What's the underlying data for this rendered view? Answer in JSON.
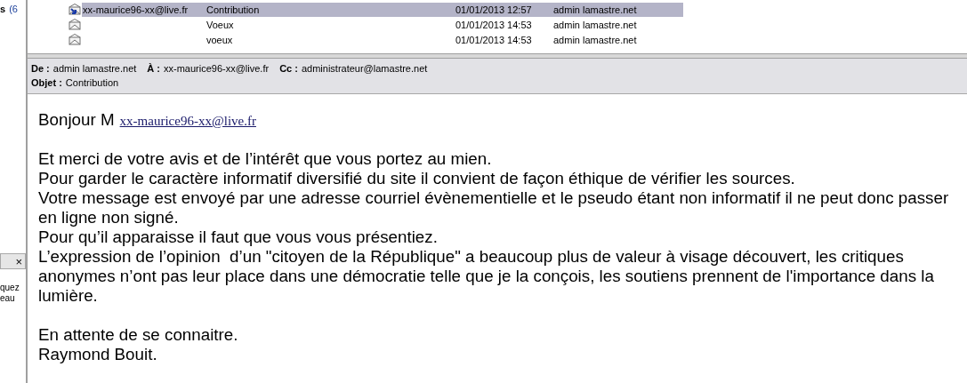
{
  "sidebar": {
    "folder_label": "s",
    "folder_count": "(6",
    "close_button": "×",
    "texts": [
      "quez",
      "eau"
    ]
  },
  "messages": [
    {
      "from": "xx-maurice96-xx@live.fr",
      "subject": "Contribution",
      "date": "01/01/2013 12:57",
      "recipient": "admin lamastre.net",
      "selected": true,
      "kind": "replied"
    },
    {
      "subject": "Voeux",
      "date": "01/01/2013 14:53",
      "recipient": "admin lamastre.net",
      "selected": false,
      "kind": "read"
    },
    {
      "subject": "voeux",
      "date": "01/01/2013 14:53",
      "recipient": "admin lamastre.net",
      "selected": false,
      "kind": "read"
    }
  ],
  "header": {
    "from_label": "De :",
    "from": "admin lamastre.net",
    "to_label": "À :",
    "to": "xx-maurice96-xx@live.fr",
    "cc_label": "Cc :",
    "cc": "administrateur@lamastre.net",
    "subject_label": "Objet :",
    "subject": "Contribution"
  },
  "body": {
    "greeting": "Bonjour M",
    "greeting_link": "xx-maurice96-xx@live.fr",
    "paragraphs": [
      "Et merci de votre avis et de l’intérêt que vous portez au mien.",
      "Pour garder le caractère informatif diversifié du site il convient de façon éthique de vérifier les sources.",
      "Votre message est envoyé par une adresse courriel évènementielle et le pseudo étant non informatif il ne peut donc passer en ligne non signé.",
      "Pour qu’il apparaisse il faut que vous vous présentiez.",
      "L’expression de l’opinion  d’un \"citoyen de la République\" a beaucoup plus de valeur à visage découvert, les critiques anonymes n’ont pas leur place dans une démocratie telle que je la conçois, les soutiens prennent de l'importance dans la lumière."
    ],
    "closing": [
      "En attente de se connaitre.",
      "Raymond Bouit."
    ]
  }
}
